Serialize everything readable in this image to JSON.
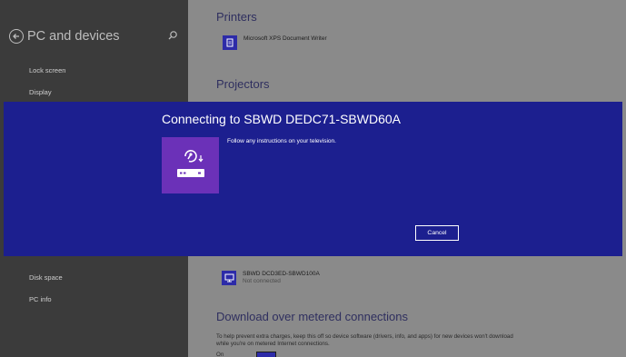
{
  "sidebar": {
    "title": "PC and devices",
    "items": [
      {
        "label": "Lock screen"
      },
      {
        "label": "Display"
      },
      {
        "label": "Disk space"
      },
      {
        "label": "PC info"
      }
    ]
  },
  "content": {
    "printers_title": "Printers",
    "printer": {
      "name": "Microsoft XPS Document Writer"
    },
    "projectors_title": "Projectors",
    "device": {
      "name": "SBWD DCD3ED-SBWD100A",
      "status": "Not connected"
    },
    "metered_title": "Download over metered connections",
    "metered_desc": "To help prevent extra charges, keep this off so device software (drivers, info, and apps) for new devices won't download while you're on metered Internet connections.",
    "metered_toggle_label": "On"
  },
  "modal": {
    "title": "Connecting to SBWD DEDC71-SBWD60A",
    "message": "Follow any instructions on your television.",
    "cancel_label": "Cancel"
  },
  "icons": {
    "back": "back-arrow-icon",
    "search": "search-icon",
    "printer": "printer-icon",
    "monitor": "monitor-icon",
    "media_receiver": "media-receiver-icon"
  },
  "colors": {
    "modal_bg": "#1c1f8f",
    "tile_bg": "#6b31b8",
    "accent": "#2d2ba8"
  }
}
